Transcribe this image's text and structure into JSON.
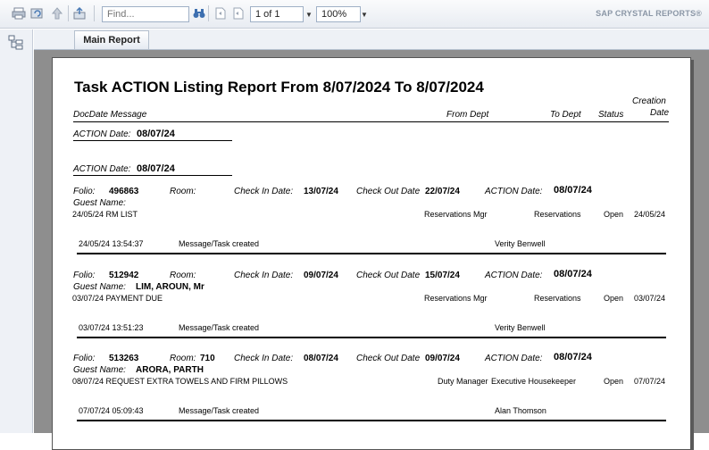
{
  "toolbar": {
    "find_placeholder": "Find...",
    "page_value": "1 of 1",
    "zoom_value": "100%",
    "brand": "SAP CRYSTAL REPORTS®"
  },
  "tabs": [
    {
      "label": "Main Report"
    }
  ],
  "report": {
    "title": "Task ACTION Listing Report From 8/07/2024 To 8/07/2024",
    "header": {
      "docdate_message": "DocDate  Message",
      "from_dept": "From Dept",
      "to_dept": "To Dept",
      "status": "Status",
      "creation": "Creation",
      "date": "Date"
    },
    "group_label": "ACTION Date:",
    "groups": [
      "08/07/24",
      "08/07/24"
    ],
    "labels": {
      "folio": "Folio:",
      "room": "Room:",
      "check_in": "Check In Date:",
      "check_out": "Check Out Date",
      "action_date": "ACTION Date:",
      "guest_name": "Guest Name:"
    },
    "records": [
      {
        "folio": "496863",
        "room": "",
        "check_in": "13/07/24",
        "check_out": "22/07/24",
        "action_date": "08/07/24",
        "guest_name": "",
        "doc_line": "24/05/24  RM LIST",
        "from_dept": "Reservations Mgr",
        "to_dept": "Reservations",
        "status": "Open",
        "creation_date": "24/05/24",
        "log_time": "24/05/24  13:54:37",
        "log_msg": "Message/Task created",
        "log_user": "Verity Benwell"
      },
      {
        "folio": "512942",
        "room": "",
        "check_in": "09/07/24",
        "check_out": "15/07/24",
        "action_date": "08/07/24",
        "guest_name": "LIM, AROUN, Mr",
        "doc_line": "03/07/24  PAYMENT DUE",
        "from_dept": "Reservations Mgr",
        "to_dept": "Reservations",
        "status": "Open",
        "creation_date": "03/07/24",
        "log_time": "03/07/24  13:51:23",
        "log_msg": "Message/Task created",
        "log_user": "Verity Benwell"
      },
      {
        "folio": "513263",
        "room": "710",
        "check_in": "08/07/24",
        "check_out": "09/07/24",
        "action_date": "08/07/24",
        "guest_name": "ARORA, PARTH",
        "doc_line": "08/07/24  REQUEST EXTRA TOWELS AND FIRM PILLOWS",
        "from_dept": "Duty Manager",
        "to_dept": "Executive Housekeeper",
        "status": "Open",
        "creation_date": "07/07/24",
        "log_time": "07/07/24  05:09:43",
        "log_msg": "Message/Task created",
        "log_user": "Alan Thomson"
      }
    ]
  },
  "icons": [
    "print-icon",
    "refresh-icon",
    "up-arrow-icon",
    "export-icon",
    "binoculars-icon",
    "first-page-icon",
    "previous-page-icon",
    "tree-icon"
  ]
}
